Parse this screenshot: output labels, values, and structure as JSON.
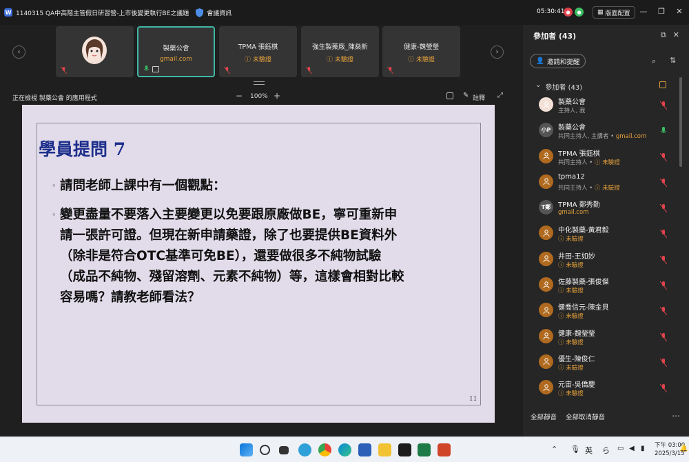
{
  "titlebar": {
    "meeting_title": "1140315 QA中高階主管假日研習營-上市後變更執行BE之議題",
    "meeting_info": "會議資訊",
    "timer": "05:30:41",
    "layout_label": "版面配置",
    "min_icon": "minimize-icon",
    "max_icon": "maximize-icon",
    "close_icon": "close-icon"
  },
  "video_strip": {
    "tiles": [
      {
        "name": "",
        "sub": ""
      },
      {
        "name": "製藥公會",
        "sub": "gmail.com"
      },
      {
        "name": "TPMA 張鈺棋",
        "sub": "未驗證"
      },
      {
        "name": "強生製藥廠_陳燊新",
        "sub": "未驗證"
      },
      {
        "name": "健康-魏瑩瑩",
        "sub": "未驗證"
      }
    ]
  },
  "share_bar": {
    "label": "正在檢視 製藥公會 的應用程式",
    "zoom_minus": "−",
    "zoom": "100%",
    "zoom_plus": "+",
    "annotate": "註釋"
  },
  "slide": {
    "title": "學員提問 7",
    "bullet_1": "請問老師上課中有一個觀點：",
    "bullet_2_lines": [
      "變更盡量不要落入主要變更以免要跟原廠做BE，寧可重新申",
      "請一張許可證。但現在新申請藥證，除了也要提供BE資料外",
      "（除非是符合OTC基準可免BE），還要做很多不純物試驗",
      "（成品不純物、殘留溶劑、元素不純物）等，這樣會相對比較",
      "容易嗎？請教老師看法？"
    ],
    "page_number": "11"
  },
  "participants": {
    "title": "參加者 (43)",
    "invite_label": "邀請和提醒",
    "group_label": "參加者 (43)",
    "list": [
      {
        "name": "製藥公會",
        "sub": "主持人, 我",
        "avatar": "",
        "avatar_color": "#f3e0d6",
        "mic": "muted"
      },
      {
        "name": "製藥公會",
        "sub": "共同主持人, 主講者 • ",
        "gmail": "gmail.com",
        "avatar": "小P",
        "avatar_color": "#555555",
        "mic": "on"
      },
      {
        "name": "TPMA 張鈺棋",
        "sub": "共同主持人 • ",
        "warn": "未驗證",
        "avatar": "",
        "avatar_color": "#b06a1f",
        "mic": "muted"
      },
      {
        "name": "tpma12",
        "sub": "共同主持人 • ",
        "warn": "未驗證",
        "avatar": "",
        "avatar_color": "#b06a1f",
        "mic": "muted"
      },
      {
        "name": "TPMA 鄭秀勤",
        "sub": "",
        "gmail": "gmail.com",
        "avatar": "T鄭",
        "avatar_color": "#555555",
        "mic": "muted"
      },
      {
        "name": "中化製藥-黃君毅",
        "sub": "",
        "warn": "未驗證",
        "avatar": "",
        "avatar_color": "#b06a1f",
        "mic": "muted"
      },
      {
        "name": "井田-王如妙",
        "sub": "",
        "warn": "未驗證",
        "avatar": "",
        "avatar_color": "#b06a1f",
        "mic": "muted"
      },
      {
        "name": "佐藤製藥-張俊傑",
        "sub": "",
        "warn": "未驗證",
        "avatar": "",
        "avatar_color": "#b06a1f",
        "mic": "muted"
      },
      {
        "name": "健喬信元-陳金貝",
        "sub": "",
        "warn": "未驗證",
        "avatar": "",
        "avatar_color": "#b06a1f",
        "mic": "muted"
      },
      {
        "name": "健康-魏瑩瑩",
        "sub": "",
        "warn": "未驗證",
        "avatar": "",
        "avatar_color": "#b06a1f",
        "mic": "muted"
      },
      {
        "name": "優生-陳俊仁",
        "sub": "",
        "warn": "未驗證",
        "avatar": "",
        "avatar_color": "#b06a1f",
        "mic": "muted"
      },
      {
        "name": "元宙-吳僑慶",
        "sub": "",
        "warn": "未驗證",
        "avatar": "",
        "avatar_color": "#b06a1f",
        "mic": "muted"
      }
    ],
    "mute_all": "全部靜音",
    "unmute_all": "全部取消靜音",
    "more": "…"
  },
  "taskbar": {
    "ime": "英",
    "time": "下午 03:00",
    "date": "2025/3/15"
  },
  "colors": {
    "accent_teal": "#3fb8a8",
    "warn_orange": "#e8a33c",
    "mute_red": "#e0434b",
    "mic_green": "#3dbd63",
    "slide_title": "#1e2f8c"
  }
}
